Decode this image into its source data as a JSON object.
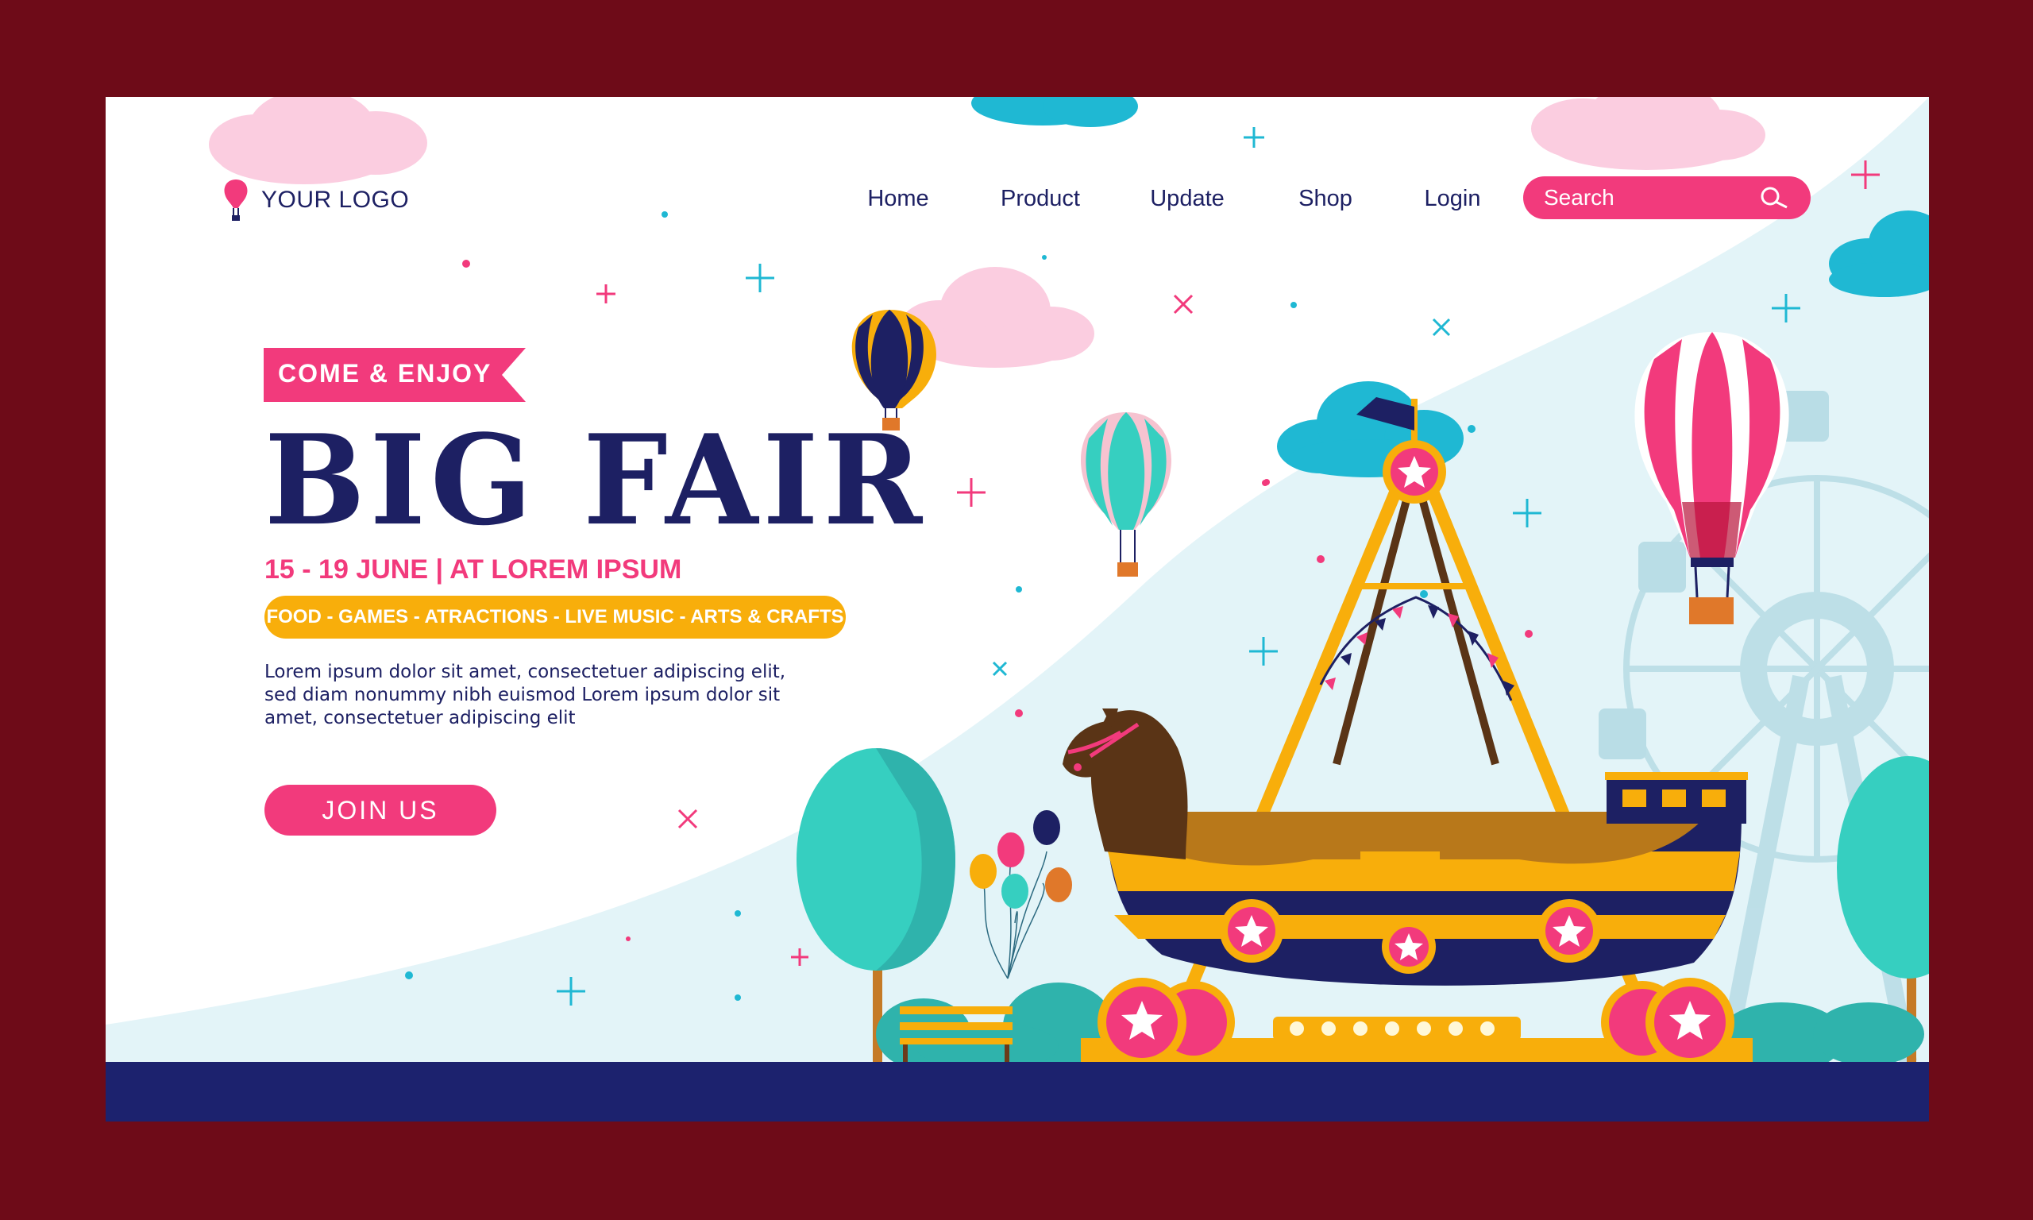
{
  "header": {
    "logo_text": "YOUR LOGO",
    "nav": [
      {
        "label": "Home"
      },
      {
        "label": "Product"
      },
      {
        "label": "Update"
      },
      {
        "label": "Shop"
      },
      {
        "label": "Login"
      }
    ],
    "search_placeholder": "Search"
  },
  "hero": {
    "ribbon": "COME & ENJOY",
    "title": "BIG FAIR",
    "dates": "15 - 19 JUNE | AT LOREM IPSUM",
    "tags": "FOOD - GAMES - ATRACTIONS - LIVE MUSIC - ARTS & CRAFTS",
    "description": "Lorem ipsum dolor sit amet, consectetuer adipiscing elit, sed diam nonummy nibh euismod Lorem ipsum dolor sit amet, consectetuer adipiscing elit",
    "cta": "JOIN US"
  },
  "colors": {
    "frame": "#6e0b18",
    "navy": "#1d2063",
    "pink": "#f23a7c",
    "orange": "#f8ae0b",
    "teal": "#36cfc0",
    "sky_blue": "#1fb8d3",
    "light_blue": "#e3f4f8"
  }
}
